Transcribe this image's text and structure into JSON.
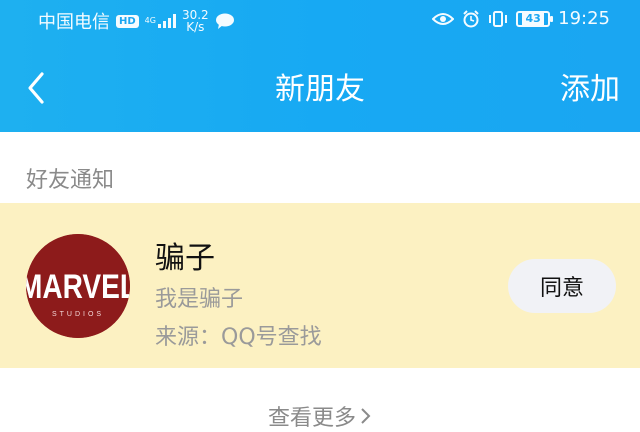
{
  "status_bar": {
    "carrier": "中国电信",
    "hd_badge": "HD",
    "network_type": "4G",
    "speed_value": "30.2",
    "speed_unit": "K/s",
    "battery_level": "43",
    "time": "19:25"
  },
  "nav": {
    "title": "新朋友",
    "add_label": "添加",
    "back_icon": "chevron-left-icon"
  },
  "section": {
    "label": "好友通知"
  },
  "request": {
    "name": "骗子",
    "note": "我是骗子",
    "source": "来源：QQ号查找",
    "avatar_text": "MARVEL",
    "avatar_subtext": "STUDIOS",
    "agree_label": "同意"
  },
  "footer": {
    "see_more": "查看更多"
  },
  "colors": {
    "header_blue": "#1aa6f2",
    "card_bg": "#fcf1c2",
    "avatar_bg": "#8d1b1b"
  }
}
